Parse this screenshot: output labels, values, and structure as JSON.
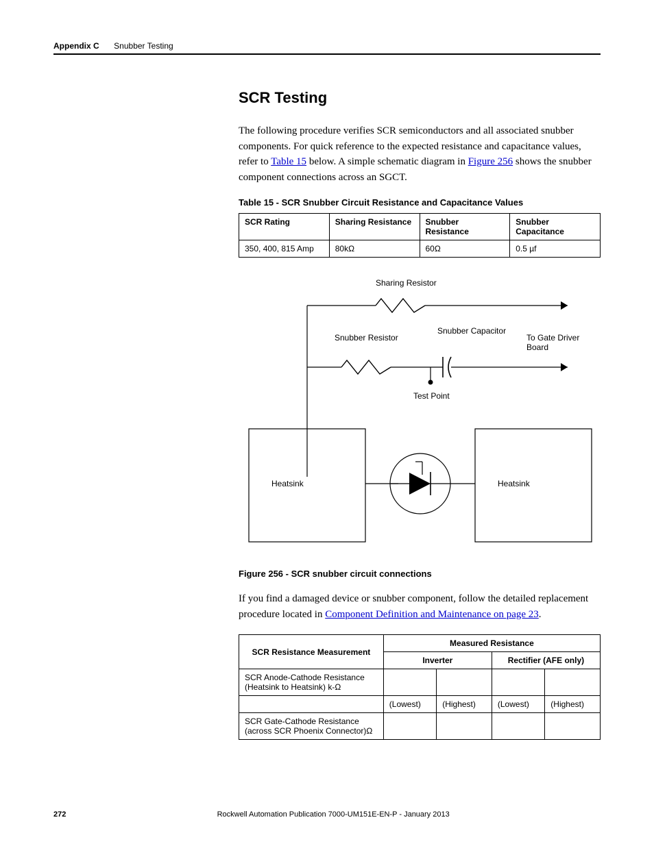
{
  "header": {
    "appendix": "Appendix C",
    "topic": "Snubber Testing"
  },
  "section": {
    "title": "SCR Testing",
    "intro_p1": "The following procedure verifies SCR semiconductors and all associated snubber components. For quick reference to the expected resistance and capacitance values, refer to ",
    "intro_link1": "Table 15",
    "intro_p2": " below. A simple schematic diagram in ",
    "intro_link2": "Figure 256",
    "intro_p3": " shows the snubber component connections across an SGCT."
  },
  "table15": {
    "caption": "Table 15 - SCR Snubber Circuit Resistance and Capacitance Values",
    "headers": [
      "SCR Rating",
      "Sharing Resistance",
      "Snubber Resistance",
      "Snubber Capacitance"
    ],
    "row": [
      "350, 400, 815 Amp",
      "80kΩ",
      "60Ω",
      "0.5 µf"
    ]
  },
  "schematic": {
    "labels": {
      "sharing_resistor": "Sharing Resistor",
      "snubber_resistor": "Snubber Resistor",
      "snubber_capacitor": "Snubber Capacitor",
      "to_gate": "To Gate Driver Board",
      "test_point": "Test Point",
      "heatsink_l": "Heatsink",
      "heatsink_r": "Heatsink"
    }
  },
  "figure256": {
    "caption": "Figure 256 - SCR snubber circuit connections"
  },
  "para2": {
    "p1": "If you find a damaged device or snubber component, follow the detailed replacement procedure located in ",
    "link": "Component Definition and Maintenance on page 23",
    "p2": "."
  },
  "table2": {
    "h1": "SCR Resistance Measurement",
    "h2": "Measured Resistance",
    "h3": "Inverter",
    "h4": "Rectifier (AFE only)",
    "r1": "SCR Anode-Cathode Resistance (Heatsink to Heatsink) k-Ω",
    "lowest": "(Lowest)",
    "highest": "(Highest)",
    "r2": "SCR Gate-Cathode Resistance (across SCR Phoenix Connector)Ω"
  },
  "footer": {
    "page": "272",
    "pub": "Rockwell Automation Publication 7000-UM151E-EN-P - January 2013"
  }
}
